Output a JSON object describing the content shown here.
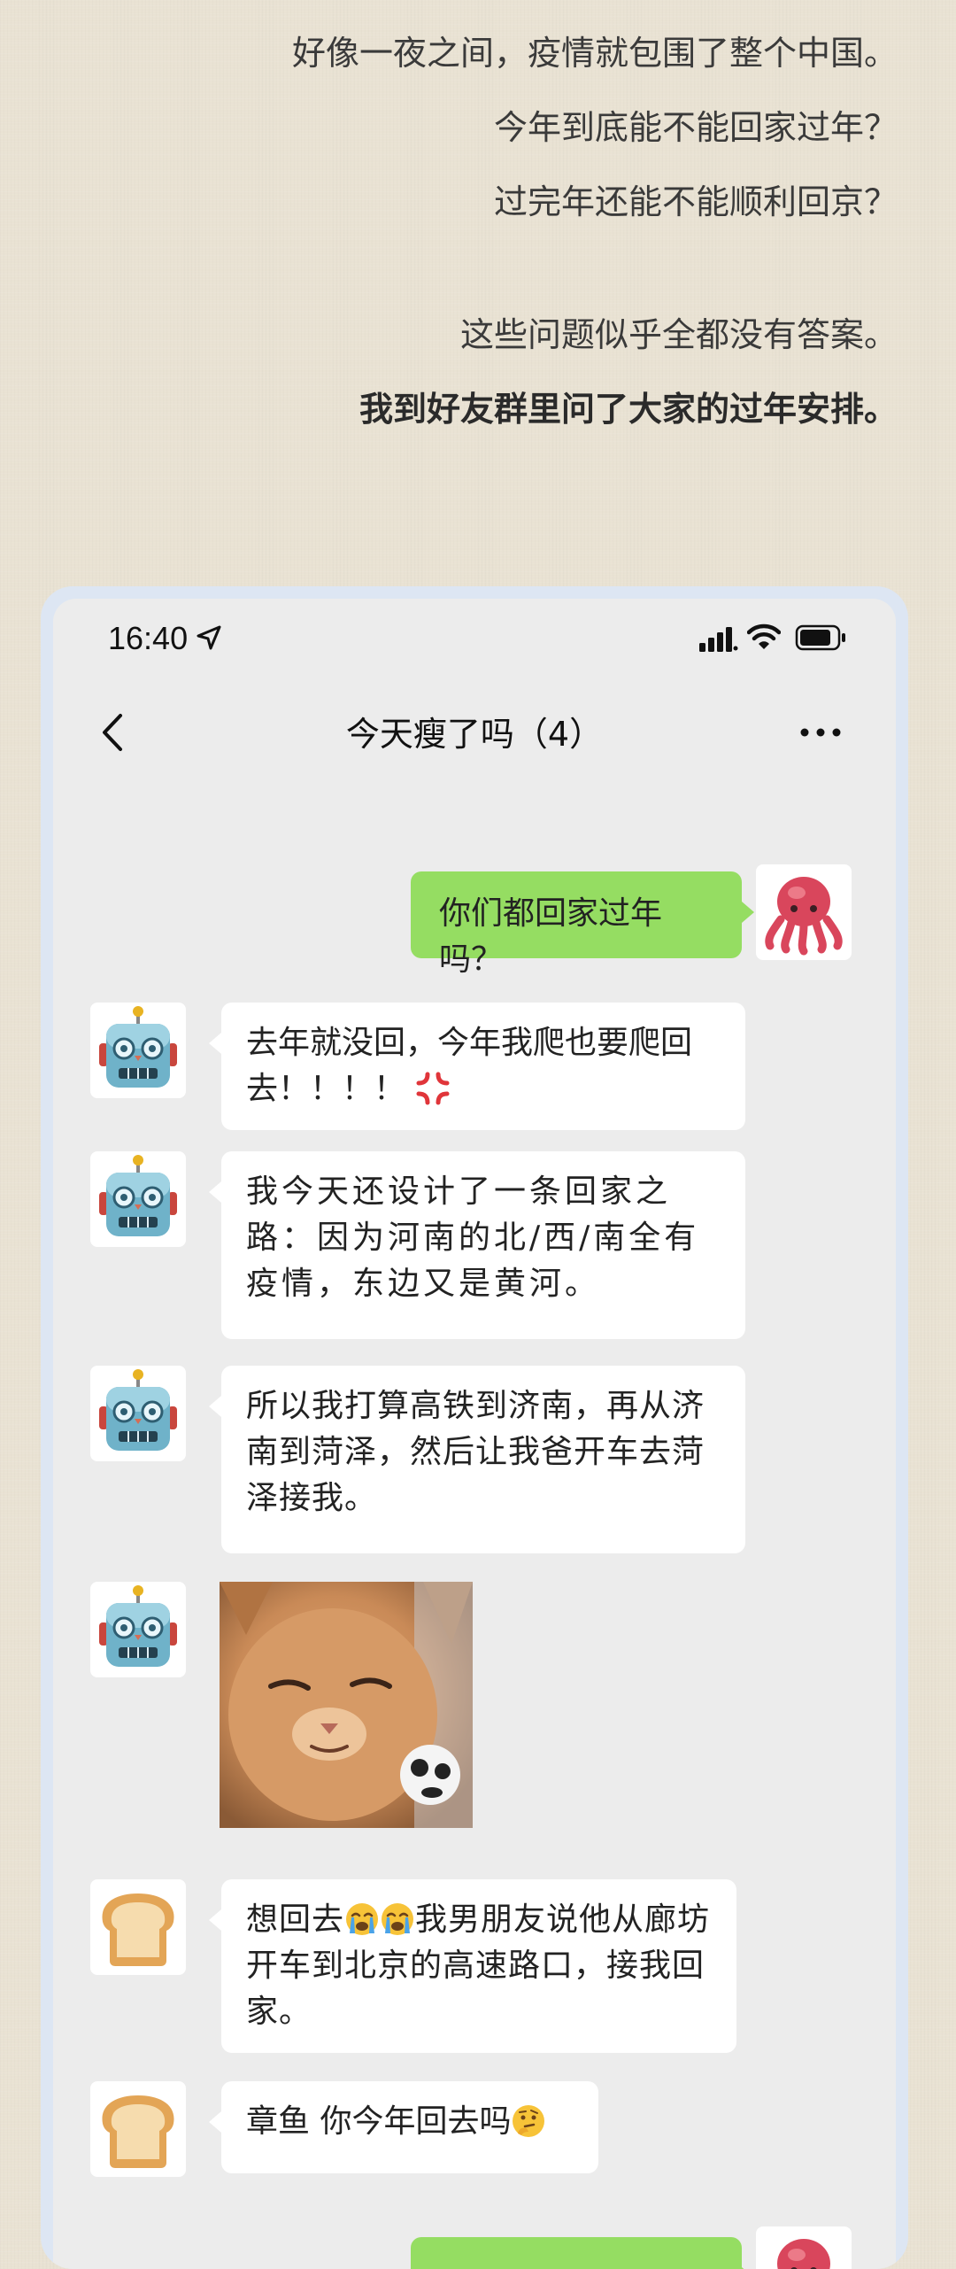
{
  "intro": {
    "line1": "好像一夜之间，疫情就包围了整个中国。",
    "line2": "今年到底能不能回家过年？",
    "line3": "过完年还能不能顺利回京？",
    "line4": "这些问题似乎全都没有答案。",
    "line5": "我到好友群里问了大家的过年安排。"
  },
  "status_bar": {
    "time": "16:40"
  },
  "nav": {
    "title": "今天瘦了吗（4）"
  },
  "chat": {
    "msg1": "你们都回家过年吗？",
    "msg2": "去年就没回，今年我爬也要爬回去！！！！",
    "msg3": "我今天还设计了一条回家之路：因为河南的北/西/南全有疫情，东边又是黄河。",
    "msg4": "所以我打算高铁到济南，再从济南到菏泽，然后让我爸开车去菏泽接我。",
    "msg6a": "想回去",
    "msg6b": "我男朋友说他从廊坊开车到北京的高速路口，接我回家。",
    "msg7": "章鱼 你今年回去吗"
  },
  "colors": {
    "page_bg": "#e9e2d3",
    "phone_frame": "#dde6f3",
    "chat_bg": "#ececec",
    "bubble_self": "#95dd62",
    "bubble_other": "#ffffff"
  },
  "icons": {
    "self_avatar": "octopus-emoji",
    "robot_avatar": "robot-emoji",
    "bread_avatar": "bread-emoji",
    "anger": "anger-symbol-emoji",
    "crying": "loudly-crying-face-emoji",
    "thinking": "thinking-face-emoji"
  }
}
